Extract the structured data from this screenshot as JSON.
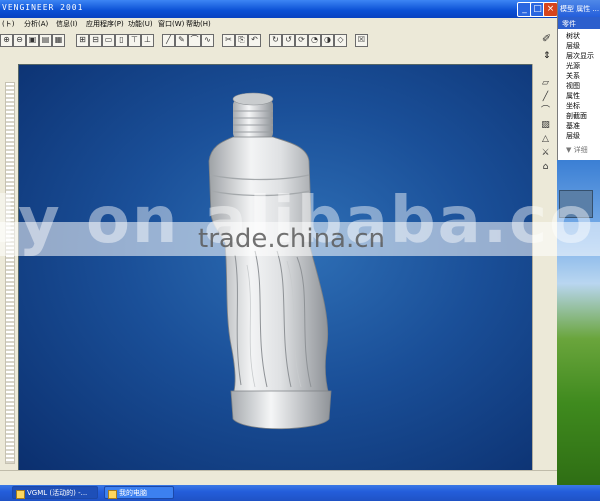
{
  "window": {
    "title": "VENGINEER 2001"
  },
  "menu": [
    "(ト)",
    "分析(A)",
    "信息(I)",
    "应用程序(P)",
    "功能(U)",
    "窗口(W)",
    "帮助(H)"
  ],
  "side_panel": {
    "header": "模型 属性 ...",
    "subheader": "零件",
    "items": [
      "树状",
      "层级",
      "层次显示",
      "光源",
      "关系",
      "视图",
      "属性",
      "坐标",
      "剖截面",
      "基准",
      "层级"
    ],
    "footer": "▼ 详细"
  },
  "taskbar": {
    "tasks": [
      {
        "label": "VGML (活动的) -..."
      },
      {
        "label": "我的电脑"
      }
    ]
  },
  "watermark": {
    "big": "ly on alibaba.com",
    "small": "trade.china.cn"
  },
  "icons": {
    "toolbar": [
      "zoom-in-icon",
      "zoom-out-icon",
      "fit-icon",
      "print-icon",
      "save-icon",
      "sep",
      "front-view-icon",
      "back-view-icon",
      "left-view-icon",
      "right-view-icon",
      "top-view-icon",
      "bottom-view-icon",
      "sep",
      "line-icon",
      "pencil-icon",
      "arc-icon",
      "spline-icon",
      "sep",
      "cut-icon",
      "paste-icon",
      "undo-icon",
      "sep",
      "rotate-x-icon",
      "rotate-y-icon",
      "rotate-z-icon",
      "spin-icon",
      "shade-icon",
      "wireframe-icon",
      "sep",
      "box-icon"
    ],
    "right": [
      "rectangle-icon",
      "line-icon",
      "curve-icon",
      "hatch-icon",
      "dimension-icon",
      "mirror-icon",
      "text-icon"
    ]
  }
}
